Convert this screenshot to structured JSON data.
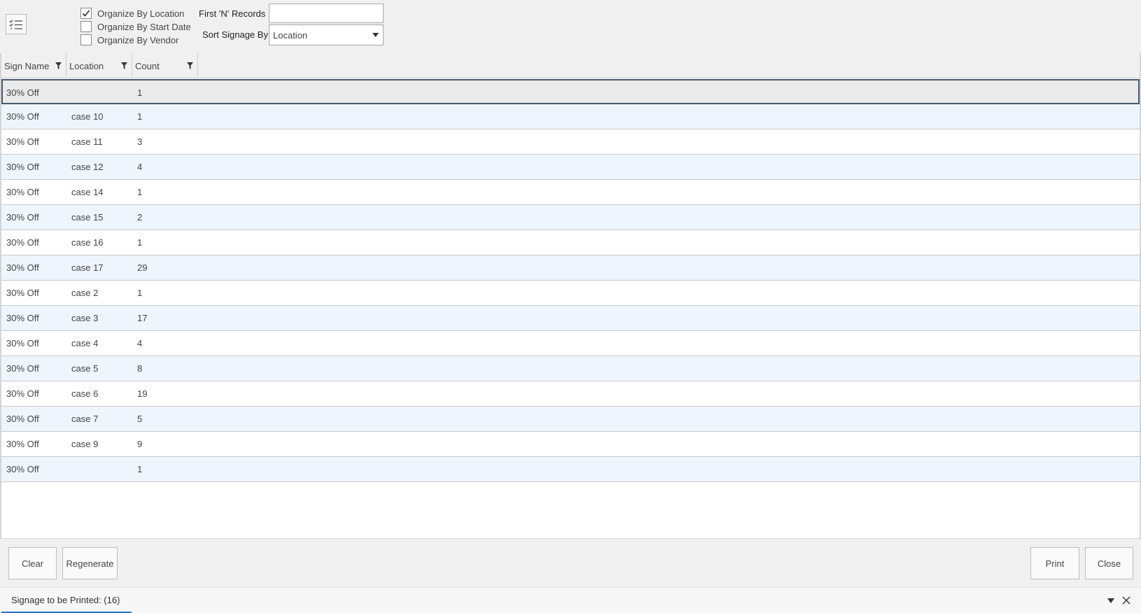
{
  "toolbar": {
    "menu_icon": "checklist-icon",
    "options": [
      {
        "label": "Organize By Location",
        "checked": true
      },
      {
        "label": "Organize By Start Date",
        "checked": false
      },
      {
        "label": "Organize By Vendor",
        "checked": false
      }
    ],
    "first_n_label": "First 'N' Records",
    "first_n_value": "",
    "sort_label": "Sort Signage By",
    "sort_value": "Location"
  },
  "grid": {
    "columns": [
      {
        "label": "Sign Name",
        "icon": "filter-icon"
      },
      {
        "label": "Location",
        "icon": "filter-icon"
      },
      {
        "label": "Count",
        "icon": "filter-icon"
      }
    ],
    "rows": [
      {
        "sign": "30% Off",
        "location": "",
        "count": "1"
      },
      {
        "sign": "30% Off",
        "location": "case 10",
        "count": "1"
      },
      {
        "sign": "30% Off",
        "location": "case 11",
        "count": "3"
      },
      {
        "sign": "30% Off",
        "location": "case 12",
        "count": "4"
      },
      {
        "sign": "30% Off",
        "location": "case 14",
        "count": "1"
      },
      {
        "sign": "30% Off",
        "location": "case 15",
        "count": "2"
      },
      {
        "sign": "30% Off",
        "location": "case 16",
        "count": "1"
      },
      {
        "sign": "30% Off",
        "location": "case 17",
        "count": "29"
      },
      {
        "sign": "30% Off",
        "location": "case 2",
        "count": "1"
      },
      {
        "sign": "30% Off",
        "location": "case 3",
        "count": "17"
      },
      {
        "sign": "30% Off",
        "location": "case 4",
        "count": "4"
      },
      {
        "sign": "30% Off",
        "location": "case 5",
        "count": "8"
      },
      {
        "sign": "30% Off",
        "location": "case 6",
        "count": "19"
      },
      {
        "sign": "30% Off",
        "location": "case 7",
        "count": "5"
      },
      {
        "sign": "30% Off",
        "location": "case 9",
        "count": "9"
      },
      {
        "sign": "30% Off",
        "location": "",
        "count": "1"
      }
    ]
  },
  "buttons": {
    "clear": "Clear",
    "regenerate": "Regenerate",
    "print": "Print",
    "close": "Close"
  },
  "status": {
    "tab_label": "Signage to be Printed: (16)",
    "icons": [
      "dropdown-icon",
      "close-icon"
    ]
  },
  "colors": {
    "accent": "#2a70c8",
    "alt_row": "#eef5fd",
    "selected_border": "#4a5a6a"
  }
}
